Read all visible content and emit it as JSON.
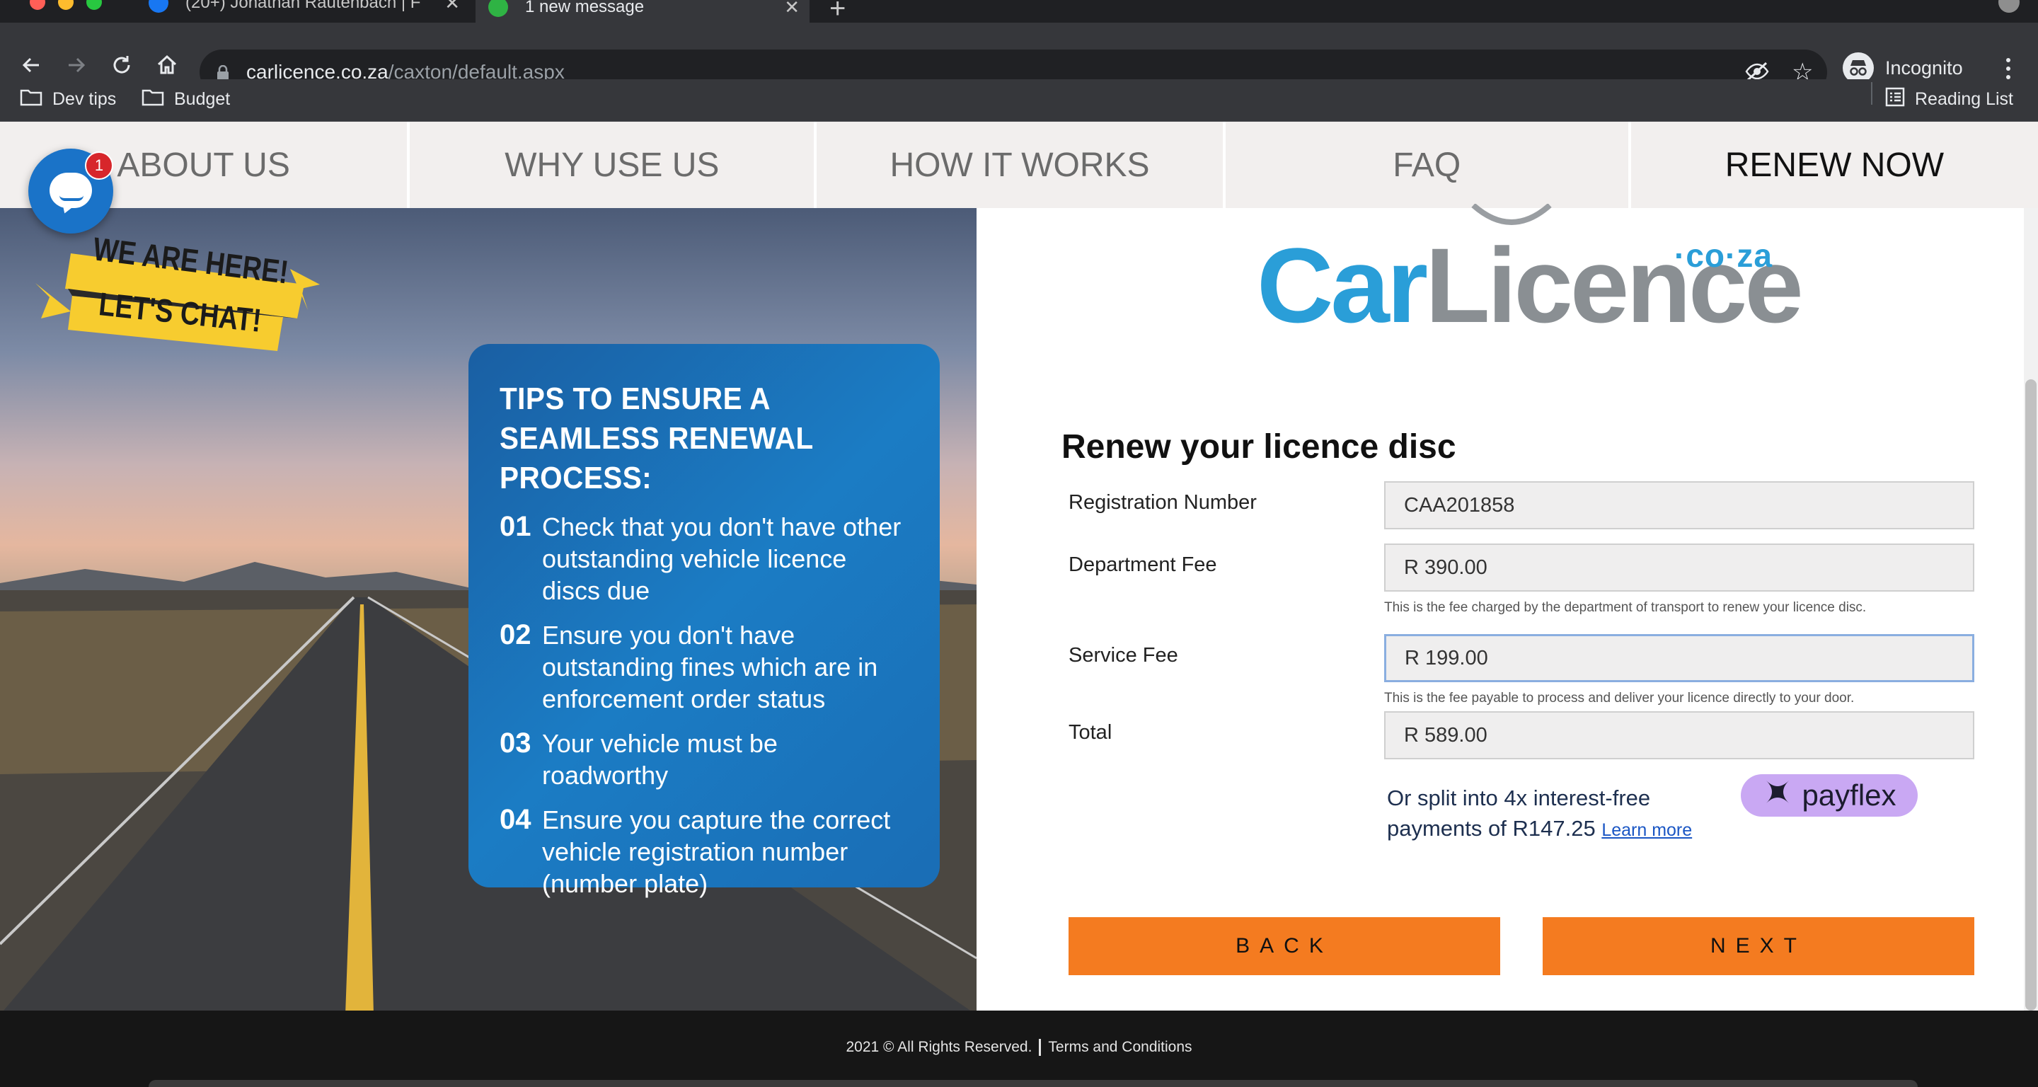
{
  "browser": {
    "tabs": [
      {
        "title": "(20+) Jonathan Rautenbach | F",
        "active": false,
        "favicon": "facebook-icon"
      },
      {
        "title": "1 new message",
        "active": true,
        "favicon": "chat-icon"
      }
    ],
    "url": {
      "host": "carlicence.co.za",
      "path": "/caxton/default.aspx"
    },
    "profile_label": "Incognito",
    "bookmarks": [
      "Dev tips",
      "Budget"
    ],
    "reading_list": "Reading List"
  },
  "nav": {
    "items": [
      "ABOUT US",
      "WHY USE US",
      "HOW IT WORKS",
      "FAQ",
      "RENEW NOW"
    ]
  },
  "chat": {
    "badge": "1",
    "banner_line1": "WE ARE HERE!",
    "banner_line2": "LET'S CHAT!"
  },
  "tips": {
    "title": "TIPS TO ENSURE A SEAMLESS RENEWAL PROCESS:",
    "items": [
      {
        "num": "01",
        "text": "Check that you don't have other outstanding vehicle licence discs due"
      },
      {
        "num": "02",
        "text": "Ensure you don't have outstanding fines which are in enforcement order status"
      },
      {
        "num": "03",
        "text": "Your vehicle must be roadworthy"
      },
      {
        "num": "04",
        "text": "Ensure you capture the correct vehicle registration number (number plate)"
      }
    ]
  },
  "logo": {
    "car": "Car",
    "licence": "Licence",
    "suffix": "·co·za"
  },
  "form": {
    "title": "Renew your licence disc",
    "registration": {
      "label": "Registration Number",
      "value": "CAA201858"
    },
    "department_fee": {
      "label": "Department Fee",
      "value": "R 390.00",
      "hint": "This is the fee charged by the department of transport to renew your licence disc."
    },
    "service_fee": {
      "label": "Service Fee",
      "value": "R 199.00",
      "hint": "This is the fee payable to process and deliver your licence directly to your door."
    },
    "total": {
      "label": "Total",
      "value": "R 589.00"
    },
    "split_line1": "Or split into 4x interest-free",
    "split_line2": "payments of R147.25",
    "learn_more": "Learn more",
    "payflex": "payflex",
    "back": "BACK",
    "next": "NEXT"
  },
  "footer": {
    "copyright": "2021 © All Rights Reserved.",
    "terms": "Terms and Conditions"
  },
  "colors": {
    "accent": "#f47b20",
    "brand_blue": "#2a9ed8",
    "tips_card": "#1b7cc4"
  }
}
